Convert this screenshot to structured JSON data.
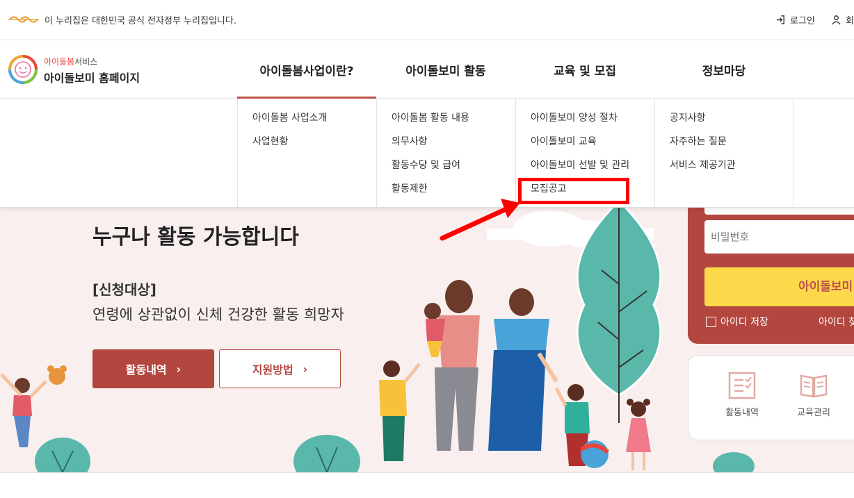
{
  "topbar": {
    "gov_notice": "이 누리집은 대한민국 공식 전자정부 누리집입니다.",
    "login_label": "로그인",
    "join_label": "회원가입"
  },
  "header": {
    "logo_sub_highlight": "아이돌봄",
    "logo_sub_rest": "서비스",
    "logo_main": "아이돌보미 홈페이지"
  },
  "gnb": [
    {
      "label": "아이돌봄사업이란?"
    },
    {
      "label": "아이돌보미 활동"
    },
    {
      "label": "교육 및 모집"
    },
    {
      "label": "정보마당"
    }
  ],
  "megamenu": [
    {
      "items": [
        "아이돌봄 사업소개",
        "사업현황"
      ]
    },
    {
      "items": [
        "아이돌봄 활동 내용",
        "의무사항",
        "활동수당 및 급여",
        "활동제한"
      ]
    },
    {
      "items": [
        "아이돌보미 양성 절차",
        "아이돌보미 교육",
        "아이돌보미 선발 및 관리",
        "모집공고"
      ]
    },
    {
      "items": [
        "공지사항",
        "자주하는 질문",
        "서비스 제공기관"
      ]
    }
  ],
  "hero": {
    "title": "누구나 활동 가능합니다",
    "target_heading": "[신청대상]",
    "target_text": "연령에 상관없이 신체 건강한 활동 희망자",
    "btn_primary": "활동내역",
    "btn_secondary": "지원방법",
    "chevron": "›"
  },
  "login_box": {
    "password_placeholder": "비밀번호",
    "login_button": "아이돌보미 로그인",
    "save_id": "아이디 저장",
    "find_id": "아이디 찾기"
  },
  "quick": [
    {
      "label": "활동내역",
      "icon": "checklist-icon"
    },
    {
      "label": "교육관리",
      "icon": "open-book-icon"
    }
  ],
  "colors": {
    "brand_red": "#b3473f",
    "active_bar": "#c0524a",
    "hero_bg": "#f8efee",
    "yellow": "#fbd94a",
    "teal": "#5ab8aa",
    "annotation_red": "#ff0000"
  }
}
